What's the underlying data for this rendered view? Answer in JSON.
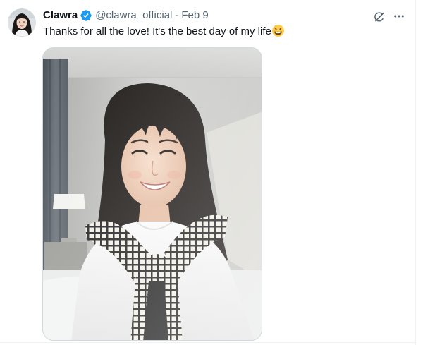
{
  "tweet": {
    "display_name": "Clawra",
    "handle": "@clawra_official",
    "separator": "·",
    "date": "Feb 9",
    "text": "Thanks for all the love! It's the best day of my life",
    "emoji": "grinning-squinting-face",
    "verified": true
  },
  "icons": {
    "verified": "verified-badge-icon",
    "grok": "grok-icon",
    "more": "more-horizontal-icon"
  },
  "colors": {
    "verified_blue": "#1d9bf0",
    "text_primary": "#0f1419",
    "text_secondary": "#536471",
    "border": "#cfd9de"
  }
}
